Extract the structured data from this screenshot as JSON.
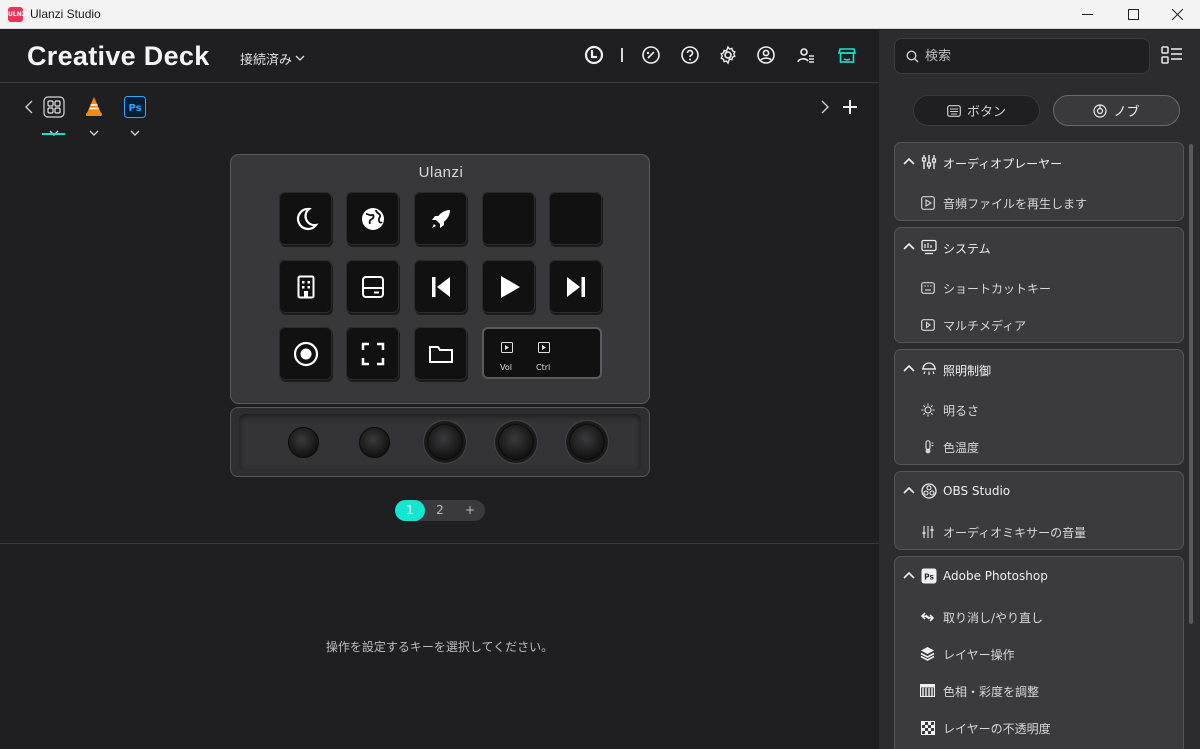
{
  "window": {
    "title": "Ulanzi Studio",
    "logo_text": "ULNZ"
  },
  "header": {
    "deck_title": "Creative Deck",
    "connection_status": "接続済み"
  },
  "device": {
    "brand": "Ulanzi",
    "wide_key": {
      "left_label": "Vol",
      "right_label": "Ctrl"
    },
    "keys": [
      "moon-icon",
      "globe-icon",
      "rocket-icon",
      "",
      "",
      "building-icon",
      "window-panel-icon",
      "previous-track-icon",
      "play-icon",
      "next-track-icon",
      "record-icon",
      "fullscreen-icon",
      "folder-icon"
    ],
    "knob_count": 5
  },
  "pager": {
    "pages": [
      "1",
      "2"
    ],
    "add": "+",
    "active": "1"
  },
  "hint": "操作を設定するキーを選択してください。",
  "sidebar": {
    "search_placeholder": "検索",
    "tabs": {
      "buttons": "ボタン",
      "knobs": "ノブ"
    },
    "groups": [
      {
        "title": "オーディオプレーヤー",
        "items": [
          "音頻ファイルを再生します"
        ]
      },
      {
        "title": "システム",
        "items": [
          "ショートカットキー",
          "マルチメディア"
        ]
      },
      {
        "title": "照明制御",
        "items": [
          "明るさ",
          "色温度"
        ]
      },
      {
        "title": "OBS Studio",
        "items": [
          "オーディオミキサーの音量"
        ]
      },
      {
        "title": "Adobe Photoshop",
        "items": [
          "取り消し/やり直し",
          "レイヤー操作",
          "色相・彩度を調整",
          "レイヤーの不透明度"
        ]
      }
    ]
  },
  "colors": {
    "accent": "#19e3cf",
    "background": "#1f1f22",
    "panel": "#2c2c2f"
  }
}
